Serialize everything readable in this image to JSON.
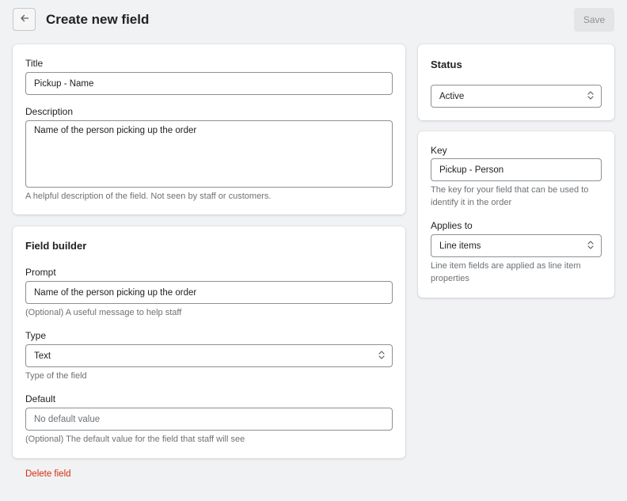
{
  "header": {
    "title": "Create new field",
    "save_label": "Save"
  },
  "details": {
    "title_label": "Title",
    "title_value": "Pickup - Name",
    "description_label": "Description",
    "description_value": "Name of the person picking up the order",
    "description_help": "A helpful description of the field. Not seen by staff or customers."
  },
  "builder": {
    "heading": "Field builder",
    "prompt_label": "Prompt",
    "prompt_value": "Name of the person picking up the order",
    "prompt_help": "(Optional) A useful message to help staff",
    "type_label": "Type",
    "type_value": "Text",
    "type_help": "Type of the field",
    "default_label": "Default",
    "default_placeholder": "No default value",
    "default_help": "(Optional) The default value for the field that staff will see"
  },
  "status": {
    "heading": "Status",
    "value": "Active"
  },
  "keycard": {
    "key_label": "Key",
    "key_value": "Pickup - Person",
    "key_help": "The key for your field that can be used to identify it in the order",
    "applies_label": "Applies to",
    "applies_value": "Line items",
    "applies_help": "Line item fields are applied as line item properties"
  },
  "footer": {
    "delete_label": "Delete field"
  },
  "colors": {
    "destructive": "#d82c0d",
    "border": "#8c9196",
    "background": "#f1f2f4"
  },
  "icons": {
    "back": "arrow-left-icon",
    "select": "chevron-updown-icon"
  }
}
